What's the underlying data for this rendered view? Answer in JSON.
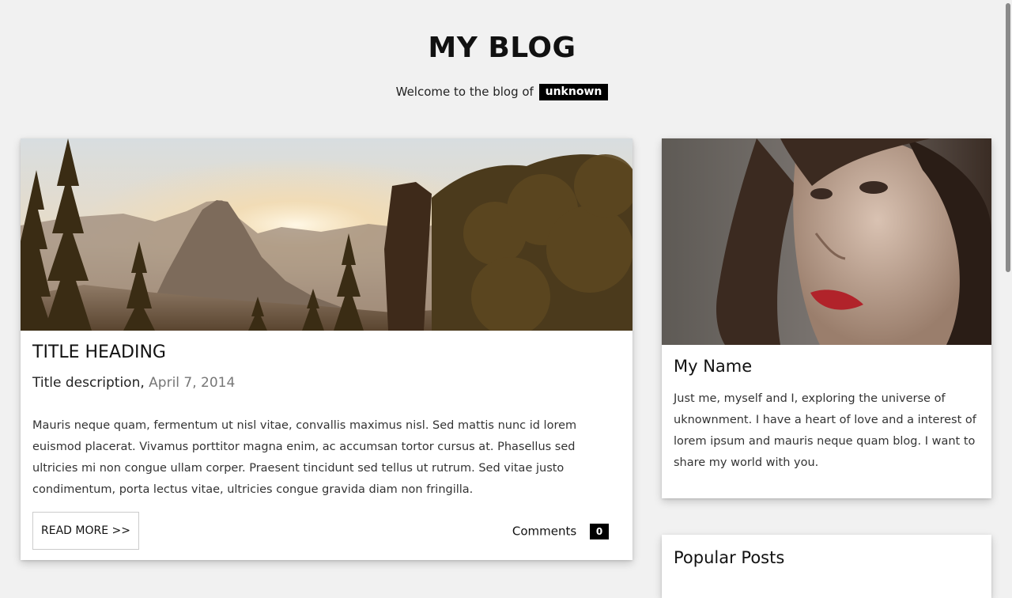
{
  "header": {
    "title": "MY BLOG",
    "tagline": "Welcome to the blog of",
    "author_tag": "unknown"
  },
  "post": {
    "image_alt": "Mountain valley at sunset with pine trees",
    "title": "TITLE HEADING",
    "description": "Title description,",
    "date": "April 7, 2014",
    "body": "Mauris neque quam, fermentum ut nisl vitae, convallis maximus nisl. Sed mattis nunc id lorem euismod placerat. Vivamus porttitor magna enim, ac accumsan tortor cursus at. Phasellus sed ultricies mi non congue ullam corper. Praesent tincidunt sed tellus ut rutrum. Sed vitae justo condimentum, porta lectus vitae, ultricies congue gravida diam non fringilla.",
    "read_more_label": "READ MORE >>",
    "comments_label": "Comments",
    "comments_count": "0"
  },
  "profile": {
    "name": "My Name",
    "bio": "Just me, myself and I, exploring the universe of uknownment. I have a heart of love and a interest of lorem ipsum and mauris neque quam blog. I want to share my world with you."
  },
  "popular": {
    "title": "Popular Posts"
  },
  "colors": {
    "background": "#f1f1f1",
    "card": "#ffffff",
    "accent": "#000000",
    "date": "#777777"
  }
}
